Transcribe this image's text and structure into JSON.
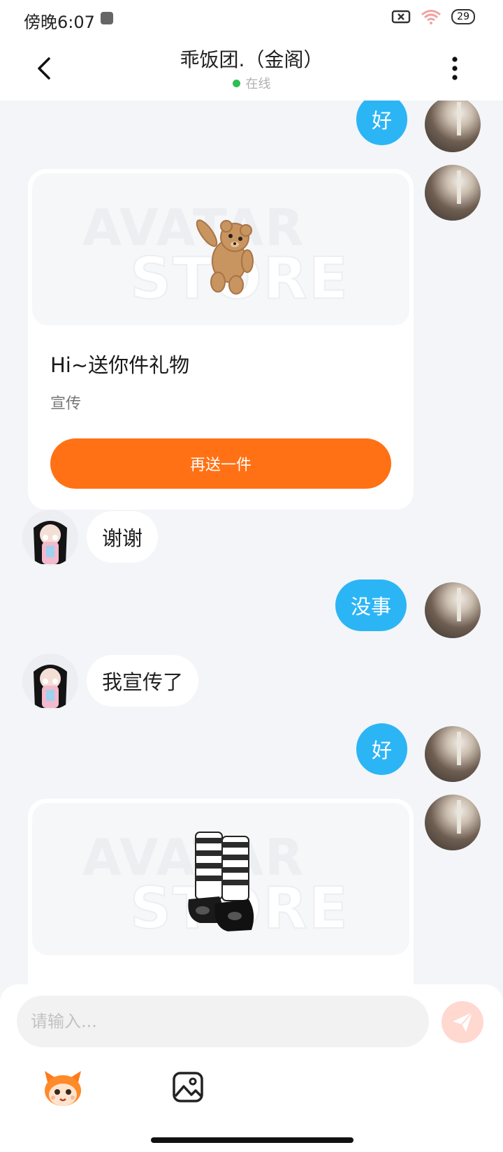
{
  "status_bar": {
    "time": "傍晚6:07",
    "battery": "29"
  },
  "header": {
    "title": "乖饭团.（金阁）",
    "status": "在线",
    "status_color": "#2dbe55"
  },
  "messages": [
    {
      "side": "self",
      "text": "好"
    },
    {
      "side": "self",
      "type": "gift_card",
      "image": "teddy-bear",
      "watermark_line1": "AVATAR",
      "watermark_line2": "STORE",
      "title": "Hi~送你件礼物",
      "subtitle": "宣传",
      "button": "再送一件"
    },
    {
      "side": "other",
      "text": "谢谢"
    },
    {
      "side": "self",
      "text": "没事"
    },
    {
      "side": "other",
      "text": "我宣传了"
    },
    {
      "side": "self",
      "text": "好"
    },
    {
      "side": "self",
      "type": "gift_card_partial",
      "image": "striped-boots",
      "watermark_line1": "AVATAR",
      "watermark_line2": "STORE"
    }
  ],
  "composer": {
    "placeholder": "请输入...",
    "send_icon": "paper-plane-icon",
    "tools": [
      "emoji-mascot-icon",
      "image-icon"
    ]
  },
  "colors": {
    "self_bubble": "#2cb5f5",
    "accent": "#ff7114",
    "background": "#f3f5f8"
  }
}
